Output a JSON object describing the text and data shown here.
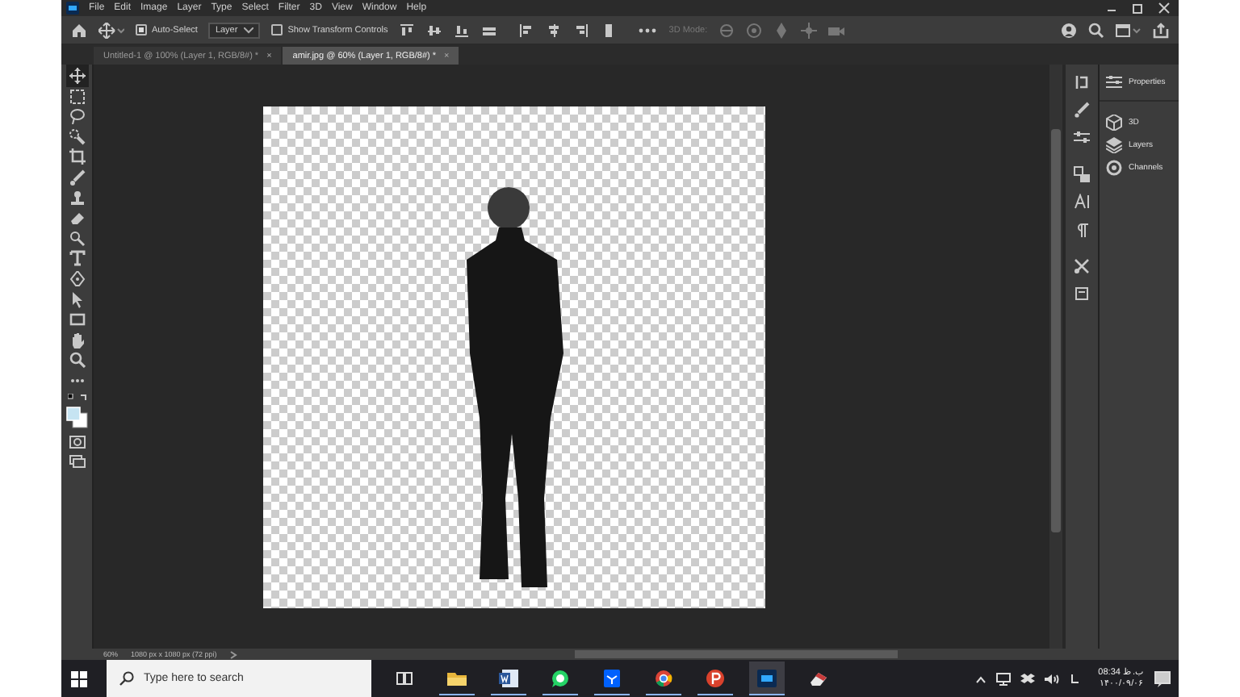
{
  "menu": [
    "File",
    "Edit",
    "Image",
    "Layer",
    "Type",
    "Select",
    "Filter",
    "3D",
    "View",
    "Window",
    "Help"
  ],
  "options_bar": {
    "auto_select": {
      "label": "Auto-Select",
      "checked": true
    },
    "target": "Layer",
    "transform_controls": {
      "label": "Show Transform Controls",
      "checked": false
    },
    "mode_3d": {
      "label": "3D Mode:",
      "disabled": true
    }
  },
  "tabs": [
    {
      "label": "Untitled-1 @ 100% (Layer 1, RGB/8#) *",
      "close": "×",
      "selected": false
    },
    {
      "label": "amir.jpg @ 60% (Layer 1, RGB/8#) *",
      "close": "×",
      "selected": true
    }
  ],
  "panels": [
    {
      "label": "Properties",
      "kind": "properties"
    },
    {
      "label": "3D",
      "kind": "cube"
    },
    {
      "label": "Layers",
      "kind": "layers"
    },
    {
      "label": "Channels",
      "kind": "channels"
    }
  ],
  "status_bar": {
    "zoom": "60%",
    "document": "1080 px x 1080 px (72 ppi)"
  },
  "taskbar": {
    "search": {
      "placeholder": "Type here to search"
    },
    "time": "08:34 ب.ظ",
    "date": "۱۴۰۰/۰۹/۰۶"
  }
}
